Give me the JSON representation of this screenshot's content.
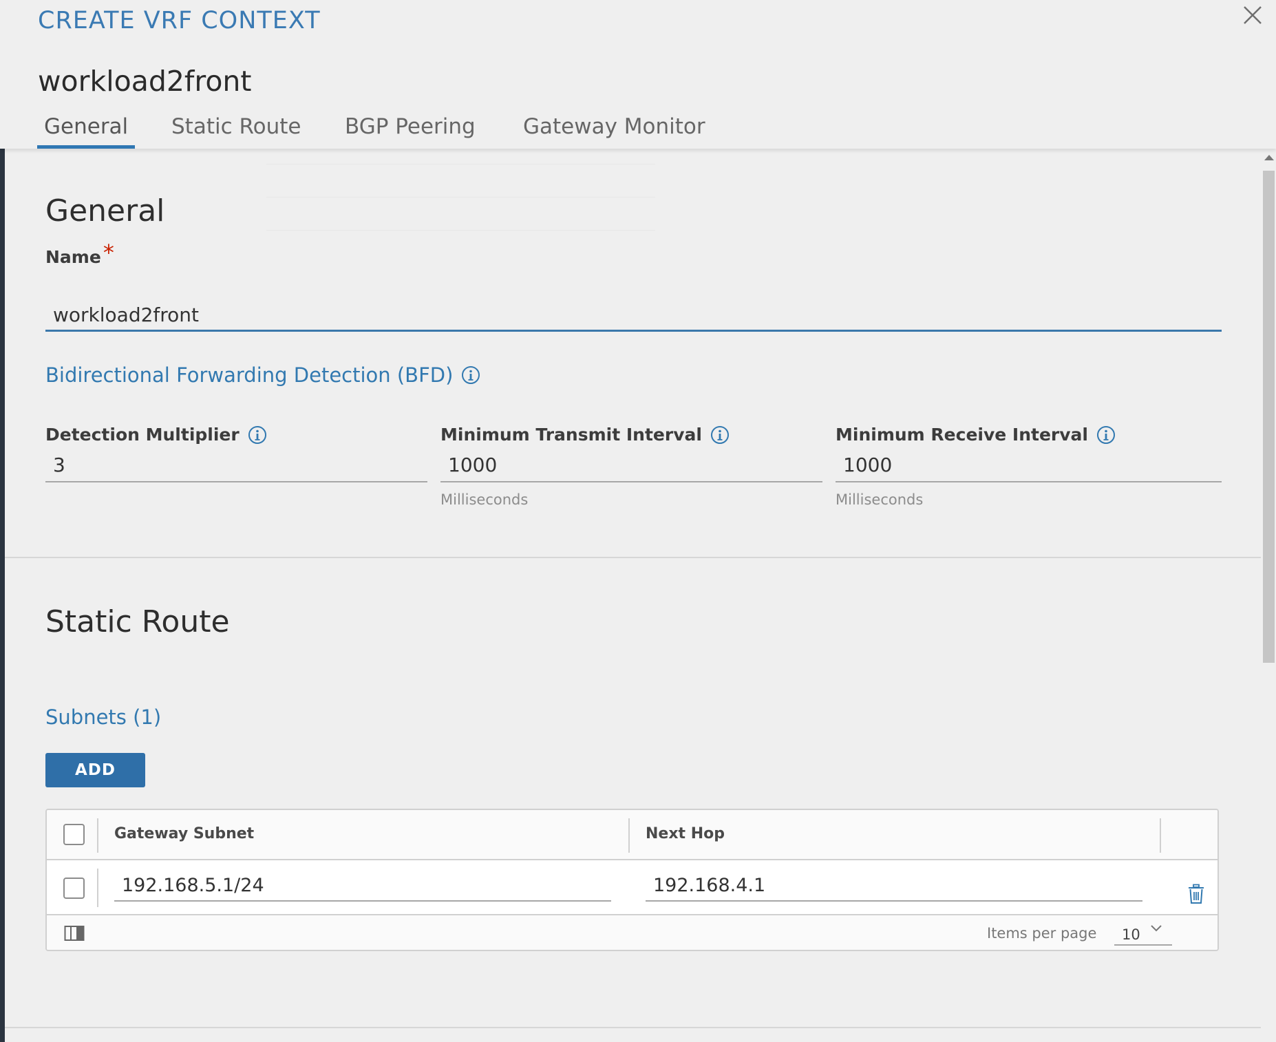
{
  "modal": {
    "title": "CREATE VRF CONTEXT",
    "object_name": "workload2front"
  },
  "tabs": [
    {
      "label": "General",
      "active": true
    },
    {
      "label": "Static Route",
      "active": false
    },
    {
      "label": "BGP Peering",
      "active": false
    },
    {
      "label": "Gateway Monitor",
      "active": false
    }
  ],
  "general": {
    "heading": "General",
    "name": {
      "label": "Name",
      "required_mark": "*",
      "value": "workload2front"
    },
    "bfd": {
      "heading": "Bidirectional Forwarding Detection (BFD)",
      "detection_multiplier": {
        "label": "Detection Multiplier",
        "value": "3"
      },
      "min_transmit_interval": {
        "label": "Minimum Transmit Interval",
        "value": "1000",
        "unit": "Milliseconds"
      },
      "min_receive_interval": {
        "label": "Minimum Receive Interval",
        "value": "1000",
        "unit": "Milliseconds"
      }
    }
  },
  "static_route": {
    "heading": "Static Route",
    "subnets_heading": "Subnets (1)",
    "add_label": "ADD",
    "grid": {
      "columns": [
        "Gateway Subnet",
        "Next Hop"
      ],
      "rows": [
        {
          "gateway_subnet": "192.168.5.1/24",
          "next_hop": "192.168.4.1"
        }
      ],
      "items_per_page_label": "Items per page",
      "items_per_page_value": "10"
    }
  },
  "colors": {
    "accent": "#2f77b3",
    "title_blue": "#3a7ab3",
    "required_red": "#c92100",
    "background": "#efefef"
  },
  "icons": [
    "close-icon",
    "info-icon",
    "trash-icon",
    "column-toggle-icon",
    "chevron-down-icon"
  ]
}
